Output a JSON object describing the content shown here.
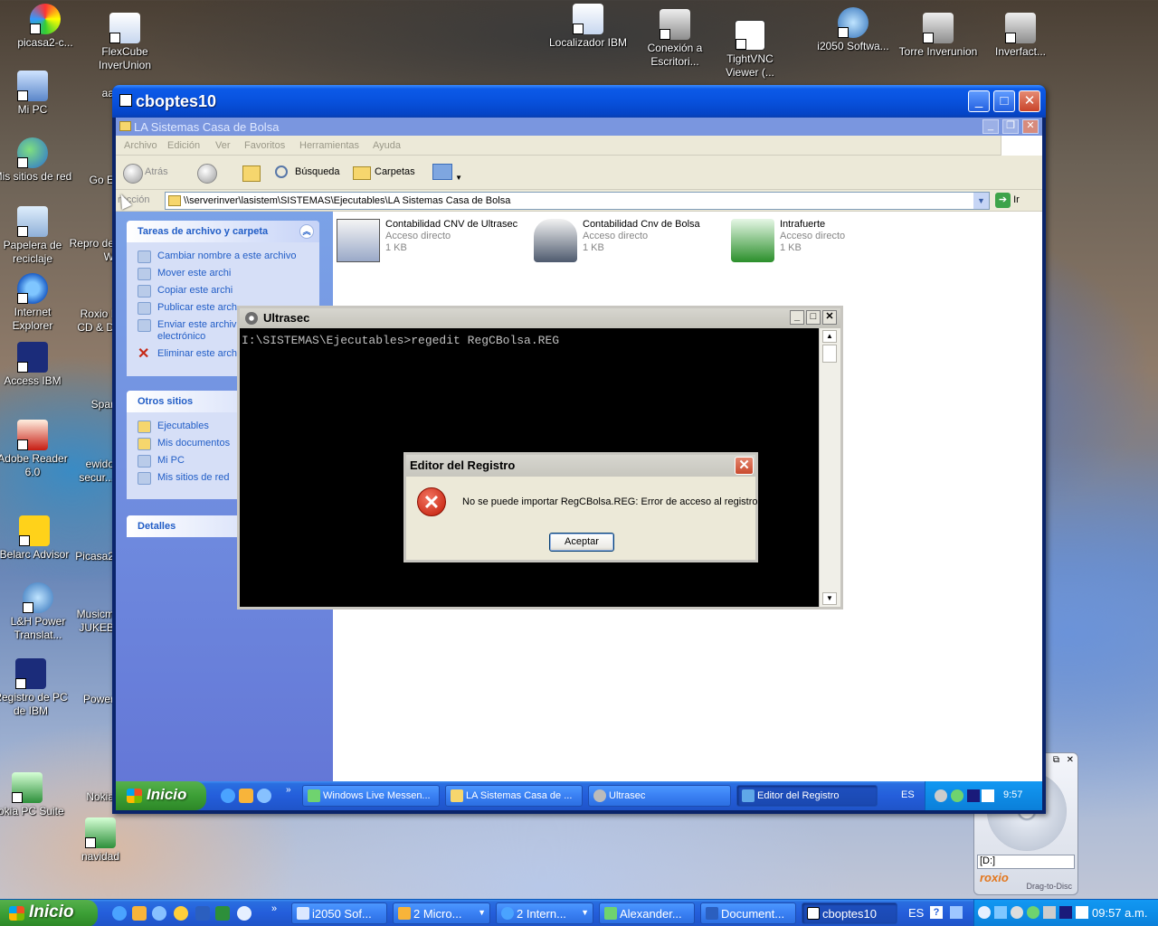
{
  "desktop": {
    "icons": [
      {
        "label": "picasa2-c...",
        "icon": "picasa-icon"
      },
      {
        "label": "FlexCube InverUnion",
        "icon": "flexcube-icon"
      },
      {
        "label": "Mi PC",
        "icon": "my-computer-icon"
      },
      {
        "label": "Mis sitios de red",
        "icon": "network-places-icon"
      },
      {
        "label": "Papelera de reciclaje",
        "icon": "recycle-bin-icon"
      },
      {
        "label": "Internet Explorer",
        "icon": "internet-explorer-icon"
      },
      {
        "label": "Access IBM",
        "icon": "access-ibm-icon"
      },
      {
        "label": "Adobe Reader 6.0",
        "icon": "adobe-reader-icon"
      },
      {
        "label": "Belarc Advisor",
        "icon": "belarc-icon"
      },
      {
        "label": "L&H Power Translat...",
        "icon": "translator-icon"
      },
      {
        "label": "Registro de PC de IBM",
        "icon": "ibm-registration-icon"
      },
      {
        "label": "Nokia PC Suite",
        "icon": "nokia-pc-suite-icon"
      },
      {
        "label": "Localizador IBM",
        "icon": "word-document-icon"
      },
      {
        "label": "Conexión a Escritori...",
        "icon": "remote-desktop-icon"
      },
      {
        "label": "TightVNC Viewer (...",
        "icon": "tightvnc-icon"
      },
      {
        "label": "i2050 Softwa...",
        "icon": "i2050-icon"
      },
      {
        "label": "Torre Inverunion",
        "icon": "server-icon"
      },
      {
        "label": "Inverfact...",
        "icon": "server-icon"
      },
      {
        "label": "aa",
        "icon": "shortcut-icon"
      },
      {
        "label": "Go E",
        "icon": "shortcut-icon"
      },
      {
        "label": "Repro de W",
        "icon": "shortcut-icon"
      },
      {
        "label": "Roxio I CD & D",
        "icon": "roxio-icon"
      },
      {
        "label": "Spar",
        "icon": "shortcut-icon"
      },
      {
        "label": "ewido secur...",
        "icon": "ewido-icon"
      },
      {
        "label": "Picasa2",
        "icon": "picasa-icon"
      },
      {
        "label": "Musicm JUKEB",
        "icon": "musicmatch-icon"
      },
      {
        "label": "Power",
        "icon": "shortcut-icon"
      },
      {
        "label": "Nokia",
        "icon": "shortcut-icon"
      },
      {
        "label": "navidad",
        "icon": "excel-icon"
      }
    ]
  },
  "outer_taskbar": {
    "start_label": "Inicio",
    "buttons": [
      {
        "label": "i2050 Sof..."
      },
      {
        "label": "2 Micro..."
      },
      {
        "label": "2 Intern..."
      },
      {
        "label": "Alexander..."
      },
      {
        "label": "Document..."
      },
      {
        "label": "cboptes10"
      }
    ],
    "language": "ES",
    "clock": "09:57 a.m."
  },
  "vnc_window": {
    "title": "cboptes10",
    "minimize_symbol": "_",
    "maximize_symbol": "□",
    "close_symbol": "✕"
  },
  "explorer": {
    "title": "LA Sistemas Casa de Bolsa",
    "menu": [
      "Archivo",
      "Edición",
      "Ver",
      "Favoritos",
      "Herramientas",
      "Ayuda"
    ],
    "toolbar": {
      "back": "Atrás",
      "search": "Búsqueda",
      "folders": "Carpetas"
    },
    "address_label": "Dirección",
    "address_label_visible": "rección",
    "address": "\\\\serverinver\\lasistem\\SISTEMAS\\Ejecutables\\LA Sistemas Casa de Bolsa",
    "go_label": "Ir",
    "tasks_panel": {
      "title": "Tareas de archivo y carpeta",
      "items": [
        "Cambiar nombre a este archivo",
        "Mover este archi",
        "Copiar este archi",
        "Publicar este arch",
        "Enviar este archiv electrónico",
        "Eliminar este arch"
      ]
    },
    "other_places": {
      "title": "Otros sitios",
      "items": [
        "Ejecutables",
        "Mis documentos",
        "Mi PC",
        "Mis sitios de red"
      ]
    },
    "details_title": "Detalles",
    "files": [
      {
        "name": "Contabilidad CNV de Ultrasec",
        "type": "Acceso directo",
        "size": "1 KB"
      },
      {
        "name": "Contabilidad Cnv de Bolsa",
        "type": "Acceso directo",
        "size": "1 KB"
      },
      {
        "name": "Intrafuerte",
        "type": "Acceso directo",
        "size": "1 KB"
      }
    ]
  },
  "console": {
    "title": "Ultrasec",
    "command": "I:\\SISTEMAS\\Ejecutables>regedit RegCBolsa.REG"
  },
  "dialog": {
    "title": "Editor del Registro",
    "message": "No se puede importar RegCBolsa.REG: Error de acceso al registro.",
    "ok_label": "Aceptar"
  },
  "inner_taskbar": {
    "start_label": "Inicio",
    "buttons": [
      {
        "label": "Windows Live Messen..."
      },
      {
        "label": "LA Sistemas Casa de ..."
      },
      {
        "label": "Ultrasec"
      },
      {
        "label": "Editor del Registro"
      }
    ],
    "language": "ES",
    "clock": "9:57"
  },
  "roxio": {
    "drive": "[D:]",
    "brand": "roxio",
    "tagline": "Drag-to-Disc"
  },
  "colors": {
    "xp_blue": "#245edb",
    "start_green": "#3c9f36",
    "panel_link": "#215dc6",
    "console_bg": "#000000",
    "console_text": "#c0c0c0",
    "error_red": "#c01a06"
  }
}
